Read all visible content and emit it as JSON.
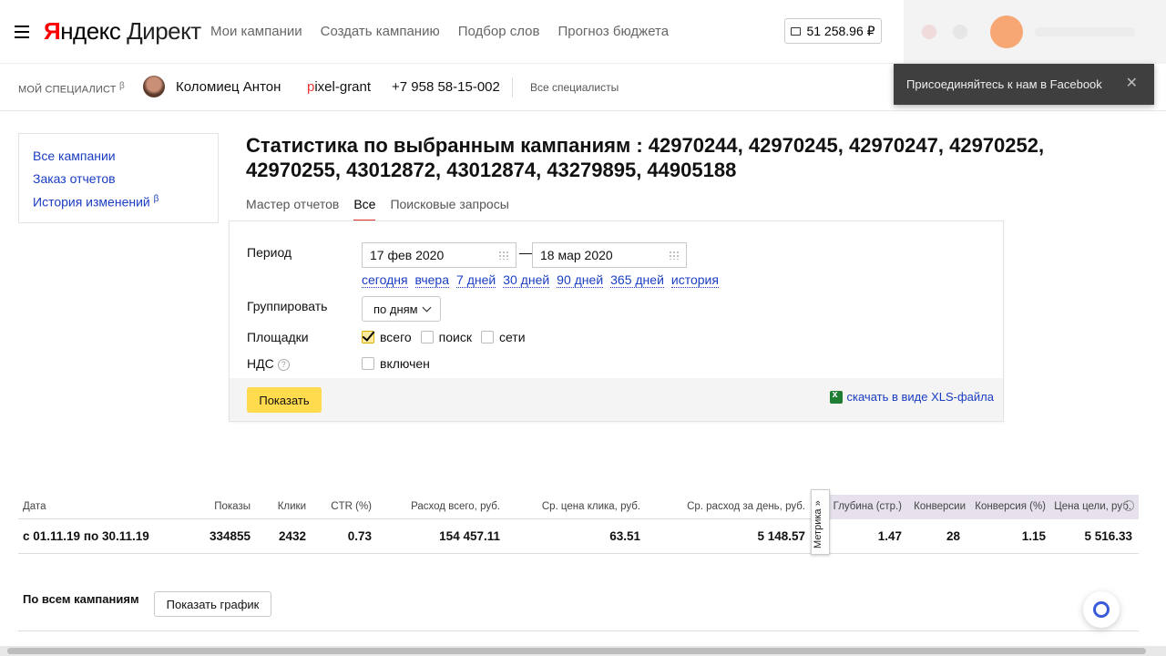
{
  "header": {
    "logo_ya": "Яндекс",
    "logo_product": "Директ",
    "nav": [
      "Мои кампании",
      "Создать кампанию",
      "Подбор слов",
      "Прогноз бюджета"
    ],
    "balance": "51 258.96 ₽"
  },
  "toast": {
    "text": "Присоединяйтесь к нам в Facebook",
    "close": "✕"
  },
  "specialist": {
    "label": "мой специалист",
    "beta": "β",
    "name": "Коломиец Антон",
    "login_first": "p",
    "login_rest": "ixel-grant",
    "phone": "+7 958 58-15-002",
    "all_link": "Все специалисты"
  },
  "sidebar": {
    "items": [
      {
        "label": "Все кампании"
      },
      {
        "label": "Заказ отчетов"
      },
      {
        "label": "История изменений"
      }
    ],
    "beta": "β"
  },
  "main": {
    "title": "Статистика по выбранным кампаниям : 42970244, 42970245, 42970247, 42970252, 42970255, 43012872, 43012874, 43279895, 44905188",
    "tabs": [
      {
        "label": "Мастер отчетов",
        "active": false
      },
      {
        "label": "Все",
        "active": true
      },
      {
        "label": "Поисковые запросы",
        "active": false
      }
    ]
  },
  "form": {
    "period_label": "Период",
    "date_from": "17 фев 2020",
    "date_sep": "—",
    "date_to": "18 мар 2020",
    "quick_periods": [
      "сегодня",
      "вчера",
      "7 дней",
      "30 дней",
      "90 дней",
      "365 дней",
      "история"
    ],
    "group_label": "Группировать",
    "group_value": "по дням",
    "platforms_label": "Площадки",
    "platforms": [
      {
        "label": "всего",
        "checked": true
      },
      {
        "label": "поиск",
        "checked": false
      },
      {
        "label": "сети",
        "checked": false
      }
    ],
    "vat_label": "НДС",
    "vat_help": "?",
    "vat_option": "включен",
    "show_button": "Показать",
    "xls_link": "скачать в виде XLS-файла"
  },
  "table": {
    "headers": [
      "Дата",
      "Показы",
      "Клики",
      "CTR (%)",
      "Расход всего, руб.",
      "Ср. цена клика, руб.",
      "Ср. расход за день, руб.",
      "Глубина (стр.)",
      "Конверсии",
      "Конверсия (%)",
      "Цена цели, руб."
    ],
    "row": [
      "с 01.11.19 по 30.11.19",
      "334855",
      "2432",
      "0.73",
      "154 457.11",
      "63.51",
      "5 148.57",
      "1.47",
      "28",
      "1.15",
      "5 516.33"
    ],
    "metrika_tab": "Метрика »"
  },
  "footer": {
    "all_campaigns": "По всем кампаниям",
    "show_chart": "Показать график"
  },
  "colors": {
    "link": "#1a3dc1",
    "accent_yellow": "#ffdb4d",
    "active_tab": "#e5322d",
    "metrika_header_bg": "#e6e1ec"
  }
}
